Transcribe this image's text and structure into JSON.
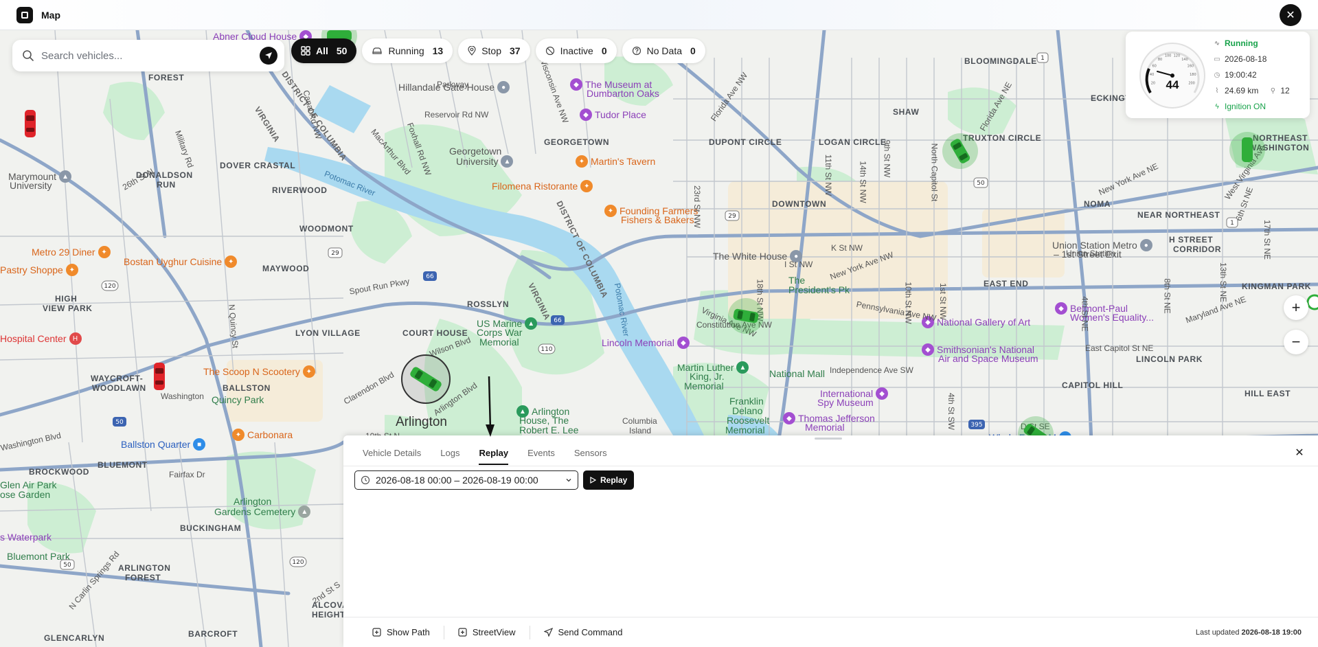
{
  "topbar": {
    "title": "Map",
    "close_icon": "close-icon"
  },
  "search": {
    "placeholder": "Search vehicles..."
  },
  "filters": [
    {
      "label": "All",
      "count": "50",
      "icon": "grid-icon"
    },
    {
      "label": "Running",
      "count": "13",
      "icon": "car-icon"
    },
    {
      "label": "Stop",
      "count": "37",
      "icon": "pin-icon"
    },
    {
      "label": "Inactive",
      "count": "0",
      "icon": "slash-icon"
    },
    {
      "label": "No Data",
      "count": "0",
      "icon": "question-icon"
    }
  ],
  "status": {
    "speed": "44",
    "state": "Running",
    "date": "2026-08-18",
    "time": "19:00:42",
    "distance": "24.69 km",
    "satellites": "12",
    "ignition": "Ignition ON",
    "gauge_ticks": [
      "20",
      "40",
      "60",
      "80",
      "100",
      "120",
      "140",
      "160",
      "180",
      "200"
    ]
  },
  "zoom": {
    "in": "+",
    "out": "−"
  },
  "panel": {
    "tabs": [
      "Vehicle Details",
      "Logs",
      "Replay",
      "Events",
      "Sensors"
    ],
    "active_tab": 2,
    "date_range": "2026-08-18 00:00 – 2026-08-19 00:00",
    "replay_label": "Replay",
    "footer": {
      "show_path": "Show Path",
      "streetview": "StreetView",
      "send_command": "Send Command",
      "last_updated_label": "Last updated",
      "last_updated_value": "2026-08-18 19:00"
    }
  },
  "map": {
    "areas": [
      {
        "t": "FOREST"
      },
      {
        "t": "DONALDSON"
      },
      {
        "t": "RUN"
      },
      {
        "t": "DOVER CRASTAL"
      },
      {
        "t": "RIVERWOOD"
      },
      {
        "t": "WOODMONT"
      },
      {
        "t": "MAYWOOD"
      },
      {
        "t": "HIGH"
      },
      {
        "t": "VIEW PARK"
      },
      {
        "t": "LYON VILLAGE"
      },
      {
        "t": "COURT HOUSE"
      },
      {
        "t": "ROSSLYN"
      },
      {
        "t": "WAYCROFT-"
      },
      {
        "t": "WOODLAWN"
      },
      {
        "t": "BALLSTON"
      },
      {
        "t": "BLUEMONT"
      },
      {
        "t": "BROCKWOOD"
      },
      {
        "t": "BUCKINGHAM"
      },
      {
        "t": "ARLINGTON"
      },
      {
        "t": "FOREST"
      },
      {
        "t": "ALCOVA"
      },
      {
        "t": "HEIGHTS"
      },
      {
        "t": "GLENCARLYN"
      },
      {
        "t": "BARCROFT"
      },
      {
        "t": "GEORGETOWN"
      },
      {
        "t": "DUPONT CIRCLE"
      },
      {
        "t": "LOGAN CIRCLE"
      },
      {
        "t": "SHAW"
      },
      {
        "t": "TRUXTON CIRCLE"
      },
      {
        "t": "BLOOMINGDALE"
      },
      {
        "t": "ECKINGTON"
      },
      {
        "t": "DOWNTOWN"
      },
      {
        "t": "NOMA"
      },
      {
        "t": "NEAR NORTHEAST"
      },
      {
        "t": "H STREET"
      },
      {
        "t": "CORRIDOR"
      },
      {
        "t": "EAST END"
      },
      {
        "t": "KINGMAN PARK"
      },
      {
        "t": "LINCOLN PARK"
      },
      {
        "t": "CAPITOL HILL"
      },
      {
        "t": "HILL EAST"
      },
      {
        "t": "NORTHEAST"
      },
      {
        "t": "WASHINGTON"
      },
      {
        "t": "Arlington"
      },
      {
        "t": "Columbia"
      },
      {
        "t": "Island"
      }
    ],
    "pois": [
      {
        "t": "Abner Cloud House",
        "c": "purple"
      },
      {
        "t": "Hillandale Gate House",
        "c": "gray"
      },
      {
        "t": "The Museum at",
        "c": "purple"
      },
      {
        "t": "Dumbarton Oaks",
        "c": "purple"
      },
      {
        "t": "Tudor Place",
        "c": "purple"
      },
      {
        "t": "Martin's Tavern",
        "c": "orange"
      },
      {
        "t": "Filomena Ristorante",
        "c": "orange"
      },
      {
        "t": "Georgetown",
        "c": "gray"
      },
      {
        "t": "University",
        "c": "gray"
      },
      {
        "t": "Founding Farmers",
        "c": "orange"
      },
      {
        "t": "Fishers & Bakers",
        "c": "orange"
      },
      {
        "t": "The White House",
        "c": "gray"
      },
      {
        "t": "The",
        "c": "green"
      },
      {
        "t": "President's Pk",
        "c": "green"
      },
      {
        "t": "Union Station Metro",
        "c": "gray"
      },
      {
        "t": "– 1st Street Exit",
        "c": "gray"
      },
      {
        "t": "National Gallery of Art",
        "c": "purple"
      },
      {
        "t": "Smithsonian's National",
        "c": "purple"
      },
      {
        "t": "Air and Space Museum",
        "c": "purple"
      },
      {
        "t": "Belmont-Paul",
        "c": "purple"
      },
      {
        "t": "Women's Equality...",
        "c": "purple"
      },
      {
        "t": "Lincoln Memorial",
        "c": "purple"
      },
      {
        "t": "US Marine",
        "c": "green"
      },
      {
        "t": "Corps War",
        "c": "green"
      },
      {
        "t": "Memorial",
        "c": "green"
      },
      {
        "t": "Martin Luther",
        "c": "green"
      },
      {
        "t": "King, Jr.",
        "c": "green"
      },
      {
        "t": "Memorial",
        "c": "green"
      },
      {
        "t": "National Mall",
        "c": "green"
      },
      {
        "t": "Franklin",
        "c": "green"
      },
      {
        "t": "Delano",
        "c": "green"
      },
      {
        "t": "Roosevelt",
        "c": "green"
      },
      {
        "t": "Memorial",
        "c": "green"
      },
      {
        "t": "International",
        "c": "purple"
      },
      {
        "t": "Spy Museum",
        "c": "purple"
      },
      {
        "t": "Thomas Jefferson",
        "c": "purple"
      },
      {
        "t": "Memorial",
        "c": "purple"
      },
      {
        "t": "Arlington",
        "c": "green"
      },
      {
        "t": "House, The",
        "c": "green"
      },
      {
        "t": "Robert E. Lee",
        "c": "green"
      },
      {
        "t": "Metro 29 Diner",
        "c": "orange"
      },
      {
        "t": "Pastry Shoppe",
        "c": "orange"
      },
      {
        "t": "Bostan Uyghur Cuisine",
        "c": "orange"
      },
      {
        "t": "Marymount",
        "c": "gray"
      },
      {
        "t": "University",
        "c": "gray"
      },
      {
        "t": "Hospital Center",
        "c": "red"
      },
      {
        "t": "The Scoop N Scootery",
        "c": "orange"
      },
      {
        "t": "Quincy Park",
        "c": "green"
      },
      {
        "t": "Carbonara",
        "c": "orange"
      },
      {
        "t": "Ballston Quarter",
        "c": "blue"
      },
      {
        "t": "Glen Air Park",
        "c": "green"
      },
      {
        "t": "ose Garden",
        "c": "green"
      },
      {
        "t": "Arlington",
        "c": "green"
      },
      {
        "t": "Gardens Cemetery",
        "c": "green"
      },
      {
        "t": "s Waterpark",
        "c": "purple"
      },
      {
        "t": "Bluemont Park",
        "c": "green"
      },
      {
        "t": "Whole Foods M",
        "c": "blue"
      }
    ],
    "streets": [
      {
        "t": "Potomac River"
      },
      {
        "t": "VIRGINIA"
      },
      {
        "t": "DISTRICT OF COLUMBIA"
      },
      {
        "t": "DISTRICT OF COLUMBIA"
      },
      {
        "t": "VIRGINIA"
      },
      {
        "t": "Potomac River"
      },
      {
        "t": "Reservoir Rd NW"
      },
      {
        "t": "MacArthur Blvd"
      },
      {
        "t": "Foxhall Rd NW"
      },
      {
        "t": "Wisconsin Ave NW"
      },
      {
        "t": "Florida Ave NW"
      },
      {
        "t": "New York Ave NE"
      },
      {
        "t": "New York Ave NW"
      },
      {
        "t": "Constitution Ave NW"
      },
      {
        "t": "Independence Ave SW"
      },
      {
        "t": "East Capitol St NE"
      },
      {
        "t": "Maryland Ave NE"
      },
      {
        "t": "Pennsylvania Ave NW"
      },
      {
        "t": "Washington Blvd"
      },
      {
        "t": "Wilson Blvd"
      },
      {
        "t": "Clarendon Blvd"
      },
      {
        "t": "Arlington Blvd"
      },
      {
        "t": "10th St N"
      },
      {
        "t": "Fairfax Dr"
      },
      {
        "t": "Spout Run Pkwy"
      },
      {
        "t": "N Quincy St"
      },
      {
        "t": "Military Rd"
      },
      {
        "t": "26th St N"
      },
      {
        "t": "N Carlin Springs Rd"
      },
      {
        "t": "2nd St S"
      },
      {
        "t": "Canal Rd NW"
      },
      {
        "t": "23rd St NW"
      },
      {
        "t": "18th St NW"
      },
      {
        "t": "10th St NW"
      },
      {
        "t": "9th St NW"
      },
      {
        "t": "1st St NW"
      },
      {
        "t": "North Capitol St"
      },
      {
        "t": "I St NW"
      },
      {
        "t": "K St NW"
      },
      {
        "t": "Union Station"
      },
      {
        "t": "D St SE"
      },
      {
        "t": "4th St SW"
      },
      {
        "t": "Virginia Ave NW"
      },
      {
        "t": "West Virginia Ave"
      },
      {
        "t": "6th St NE"
      },
      {
        "t": "17th St NE"
      },
      {
        "t": "14th St NW"
      },
      {
        "t": "11th St NW"
      },
      {
        "t": "4th St NE"
      },
      {
        "t": "8th St NE"
      },
      {
        "t": "13th St NE"
      },
      {
        "t": "Parkway"
      },
      {
        "t": "Florida Ave NE"
      },
      {
        "t": "Washington"
      }
    ],
    "shields": [
      "29",
      "29",
      "66",
      "66",
      "110",
      "120",
      "120",
      "50",
      "50",
      "50",
      "1",
      "1",
      "395"
    ]
  }
}
